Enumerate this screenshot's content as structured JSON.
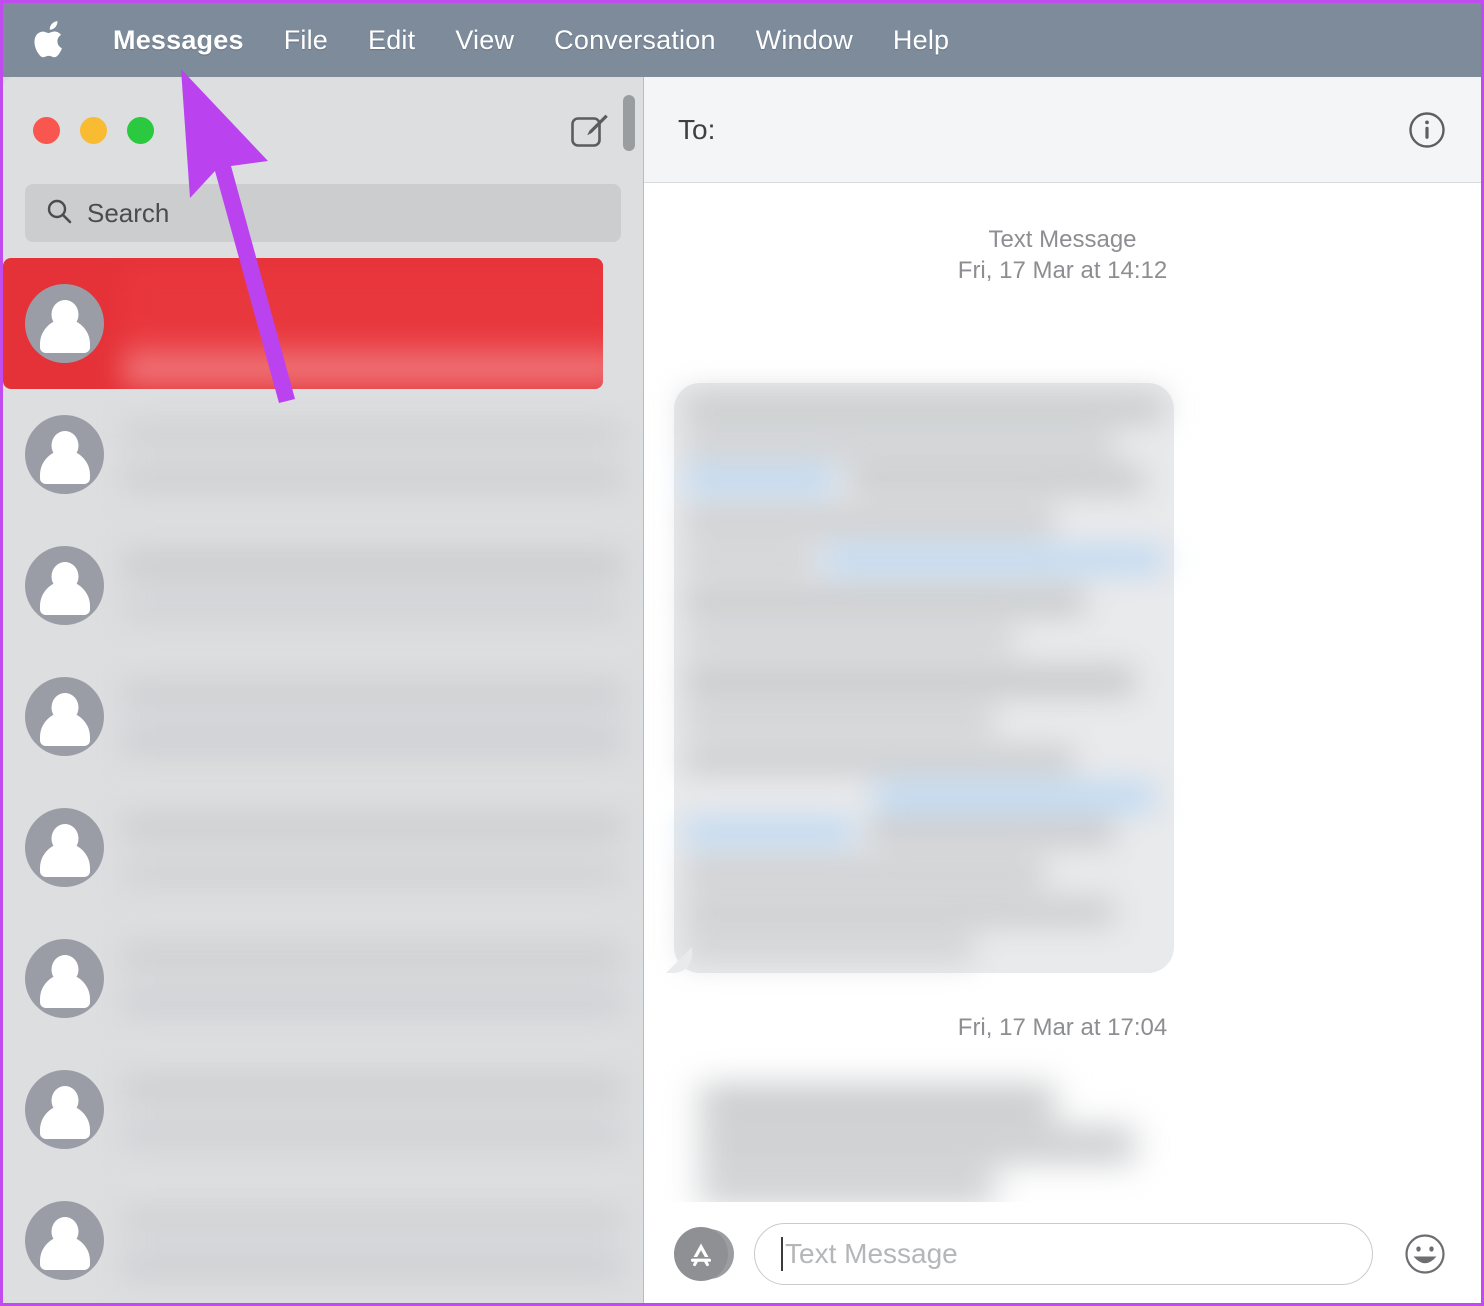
{
  "menubar": {
    "apple_icon": "apple-logo-icon",
    "items": [
      {
        "label": "Messages",
        "bold": true
      },
      {
        "label": "File",
        "bold": false
      },
      {
        "label": "Edit",
        "bold": false
      },
      {
        "label": "View",
        "bold": false
      },
      {
        "label": "Conversation",
        "bold": false
      },
      {
        "label": "Window",
        "bold": false
      },
      {
        "label": "Help",
        "bold": false
      }
    ],
    "background_color": "#7d8b9b",
    "text_color": "#ffffff"
  },
  "window": {
    "traffic_lights": {
      "close_color": "#f9564f",
      "minimize_color": "#f9bb32",
      "maximize_color": "#2ac940"
    },
    "compose_icon": "compose-pencil-icon"
  },
  "sidebar": {
    "search": {
      "placeholder": "Search",
      "icon": "search-icon"
    },
    "conversations": [
      {
        "selected": true,
        "avatar_icon": "person-avatar-icon",
        "redacted": true
      },
      {
        "selected": false,
        "avatar_icon": "person-avatar-icon",
        "redacted": true
      },
      {
        "selected": false,
        "avatar_icon": "person-avatar-icon",
        "redacted": true
      },
      {
        "selected": false,
        "avatar_icon": "person-avatar-icon",
        "redacted": true
      },
      {
        "selected": false,
        "avatar_icon": "person-avatar-icon",
        "redacted": true
      },
      {
        "selected": false,
        "avatar_icon": "person-avatar-icon",
        "redacted": true
      },
      {
        "selected": false,
        "avatar_icon": "person-avatar-icon",
        "redacted": true
      },
      {
        "selected": false,
        "avatar_icon": "person-avatar-icon",
        "redacted": true
      }
    ],
    "selected_row_color": "#e53238",
    "background_color": "#dcdee0",
    "scrollbar": "vertical-scrollbar"
  },
  "conversation": {
    "to_label": "To:",
    "info_icon": "info-circle-icon",
    "messages": [
      {
        "service_label": "Text Message",
        "timestamp": "Fri, 17 Mar at 14:12",
        "direction": "incoming",
        "redacted": true
      },
      {
        "service_label": "",
        "timestamp": "Fri, 17 Mar at 17:04",
        "direction": "incoming",
        "redacted": true
      }
    ]
  },
  "compose": {
    "apps_icon": "app-store-icon",
    "input_placeholder": "Text Message",
    "input_value": "",
    "emoji_icon": "smiley-face-icon"
  },
  "annotation": {
    "arrow_color": "#bb42ef",
    "points_to": "Messages menu item",
    "border_color": "#c24bf0"
  }
}
